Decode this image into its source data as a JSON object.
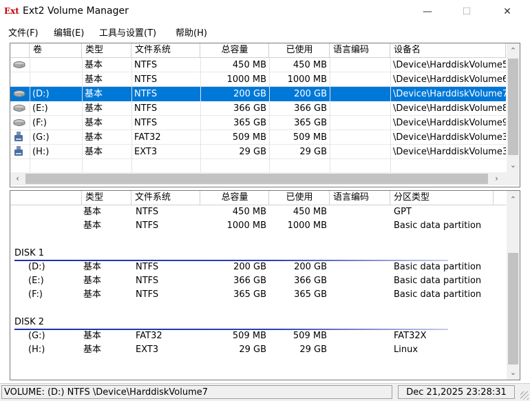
{
  "window": {
    "title": "Ext2 Volume Manager",
    "icon_text": "Ext",
    "minimize_glyph": "—",
    "maximize_glyph": "☐",
    "close_glyph": "✕"
  },
  "menu": [
    {
      "label": "文件(F)"
    },
    {
      "label": "编辑(E)"
    },
    {
      "label": "工具与设置(T)"
    },
    {
      "label": "帮助(H)"
    }
  ],
  "volumes_table": {
    "headers": [
      "卷",
      "类型",
      "文件系统",
      "总容量",
      "已使用",
      "语言编码",
      "设备名"
    ],
    "rows": [
      {
        "icon": "drive-icon",
        "volume": "",
        "type": "基本",
        "fs": "NTFS",
        "total": "450 MB",
        "used": "450 MB",
        "codepage": "",
        "device": "\\Device\\HarddiskVolume5"
      },
      {
        "icon": "",
        "volume": "",
        "type": "基本",
        "fs": "NTFS",
        "total": "1000 MB",
        "used": "1000 MB",
        "codepage": "",
        "device": "\\Device\\HarddiskVolume6"
      },
      {
        "icon": "drive-icon",
        "volume": "(D:)",
        "type": "基本",
        "fs": "NTFS",
        "total": "200 GB",
        "used": "200 GB",
        "codepage": "",
        "device": "\\Device\\HarddiskVolume7",
        "selected": true
      },
      {
        "icon": "drive-icon",
        "volume": "(E:)",
        "type": "基本",
        "fs": "NTFS",
        "total": "366 GB",
        "used": "366 GB",
        "codepage": "",
        "device": "\\Device\\HarddiskVolume8"
      },
      {
        "icon": "drive-icon",
        "volume": "(F:)",
        "type": "基本",
        "fs": "NTFS",
        "total": "365 GB",
        "used": "365 GB",
        "codepage": "",
        "device": "\\Device\\HarddiskVolume9"
      },
      {
        "icon": "usb-drive-icon",
        "volume": "(G:)",
        "type": "基本",
        "fs": "FAT32",
        "total": "509 MB",
        "used": "509 MB",
        "codepage": "",
        "device": "\\Device\\HarddiskVolume3"
      },
      {
        "icon": "usb-drive-icon",
        "volume": "(H:)",
        "type": "基本",
        "fs": "EXT3",
        "total": "29 GB",
        "used": "29 GB",
        "codepage": "",
        "device": "\\Device\\HarddiskVolume3"
      }
    ]
  },
  "disks_table": {
    "headers": [
      "",
      "类型",
      "文件系统",
      "总容量",
      "已使用",
      "语言编码",
      "分区类型"
    ],
    "groups": [
      {
        "label": "",
        "partitions": [
          {
            "volume": "",
            "type": "基本",
            "fs": "NTFS",
            "total": "450 MB",
            "used": "450 MB",
            "ptype": "GPT"
          },
          {
            "volume": "",
            "type": "基本",
            "fs": "NTFS",
            "total": "1000 MB",
            "used": "1000 MB",
            "ptype": "Basic data partition"
          }
        ]
      },
      {
        "label": "DISK 1",
        "partitions": [
          {
            "volume": "(D:)",
            "type": "基本",
            "fs": "NTFS",
            "total": "200 GB",
            "used": "200 GB",
            "ptype": "Basic data partition"
          },
          {
            "volume": "(E:)",
            "type": "基本",
            "fs": "NTFS",
            "total": "366 GB",
            "used": "366 GB",
            "ptype": "Basic data partition"
          },
          {
            "volume": "(F:)",
            "type": "基本",
            "fs": "NTFS",
            "total": "365 GB",
            "used": "365 GB",
            "ptype": "Basic data partition"
          }
        ]
      },
      {
        "label": "DISK 2",
        "partitions": [
          {
            "volume": "(G:)",
            "type": "基本",
            "fs": "FAT32",
            "total": "509 MB",
            "used": "509 MB",
            "ptype": "FAT32X"
          },
          {
            "volume": "(H:)",
            "type": "基本",
            "fs": "EXT3",
            "total": "29 GB",
            "used": "29 GB",
            "ptype": "Linux"
          }
        ]
      }
    ]
  },
  "status": {
    "left": "VOLUME: (D:) NTFS \\Device\\HarddiskVolume7",
    "right": "Dec 21,2025 23:28:31"
  },
  "colors": {
    "selection": "#0078d7",
    "disk_line": "#1c2fa8",
    "icon_red": "#c00000"
  }
}
